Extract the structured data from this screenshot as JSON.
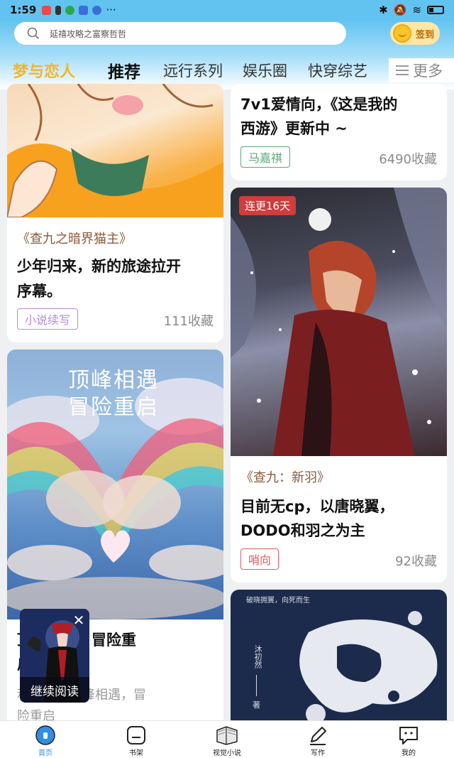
{
  "status": {
    "time": "1:59",
    "more": "···"
  },
  "search": {
    "placeholder": "延禧攻略之富察哲哲",
    "signin_label": "签到"
  },
  "tabs": {
    "brand": "梦与恋人",
    "active": "推荐",
    "t3": "远行系列",
    "t4": "娱乐圈",
    "t5": "快穿综艺",
    "more": "更多"
  },
  "cards": {
    "c1": {
      "book": "《查九之暗界猫主》",
      "title_l1": "少年归来，新的旅途拉开",
      "title_l2": "序幕。",
      "tag": "小说续写",
      "count": "111收藏"
    },
    "c2": {
      "title_l1": "7v1爱情向，《这是我的",
      "title_l2": "西游》更新中 ~",
      "tag": "马嘉祺",
      "count": "6490收藏"
    },
    "c3": {
      "cover_l1": "顶峰相遇",
      "cover_l2": "冒险重启",
      "title_l1": "顶峰相遇，冒险重",
      "title_l2": "启",
      "desc_l1": "和DODO顶峰相遇，冒",
      "desc_l2": "险重启"
    },
    "c4": {
      "badge": "连更16天",
      "book": "《查九：新羽》",
      "title_l1": "目前无cp，以唐晓翼，",
      "title_l2": "DODO和羽之为主",
      "tag": "哨向",
      "count": "92收藏"
    },
    "c5": {
      "cover_top": "破晓拥翼，向死而生",
      "cover_author": "沐初然",
      "cover_zhu": "著"
    }
  },
  "floater": {
    "label": "继续阅读",
    "close": "✕"
  },
  "nav": {
    "home": "首页",
    "shelf": "书架",
    "visual": "视觉小说",
    "write": "写作",
    "mine": "我的"
  },
  "colors": {
    "brand": "#f5b42b",
    "accent": "#2f8ee8",
    "badge": "#cf3d3d",
    "tag_purple": "#b48be0",
    "tag_green": "#5aa877",
    "tag_red": "#e25c5c"
  }
}
